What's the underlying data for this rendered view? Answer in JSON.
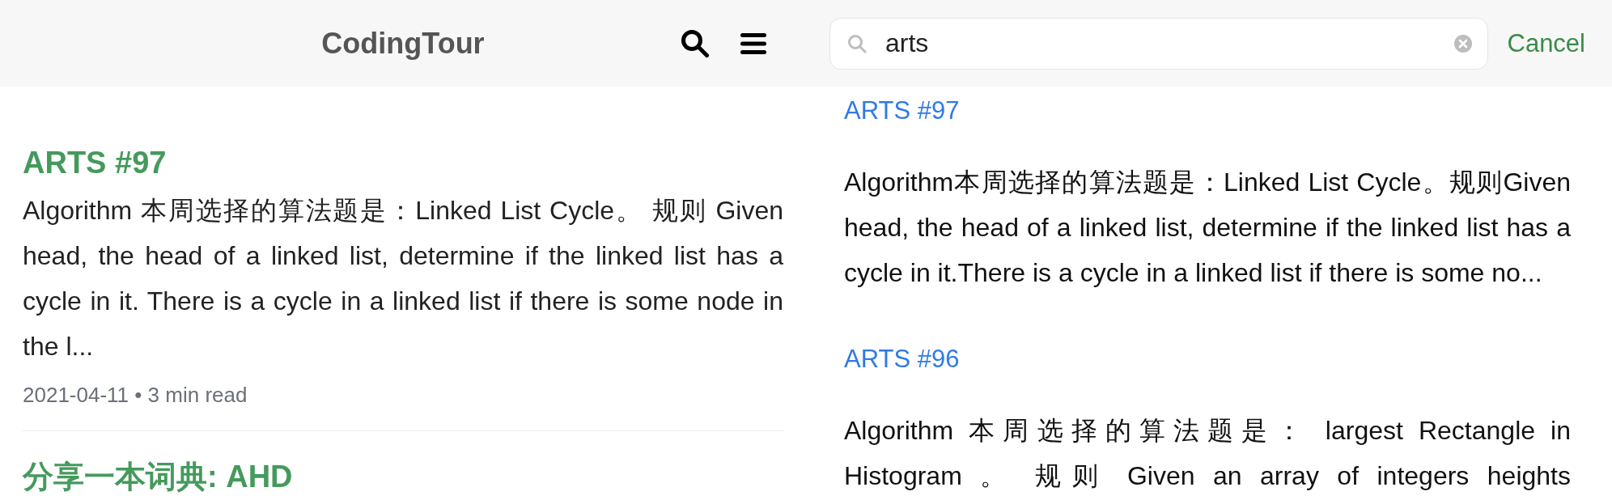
{
  "header": {
    "title": "CodingTour"
  },
  "posts": [
    {
      "title": "ARTS #97",
      "excerpt": "Algorithm 本周选择的算法题是：Linked List Cycle。 规则 Given head, the head of a linked list, determine if the linked list has a cycle in it. There is a cycle in a linked list if there is some node in the l...",
      "meta": "2021-04-11 • 3 min read"
    },
    {
      "title": "分享一本词典: AHD"
    }
  ],
  "search": {
    "value": "arts",
    "cancel": "Cancel"
  },
  "results": [
    {
      "title": "ARTS #97",
      "snippet": "Algorithm本周选择的算法题是：Linked List Cycle。规则Given head, the head of a linked list, determine if the linked list has a cycle in it.There is a cycle in a linked list if there is some no..."
    },
    {
      "title": "ARTS #96",
      "snippet": "Algorithm 本周选择的算法题是： largest Rectangle in Histogram 。 规则 Given an array of integers heights"
    }
  ]
}
